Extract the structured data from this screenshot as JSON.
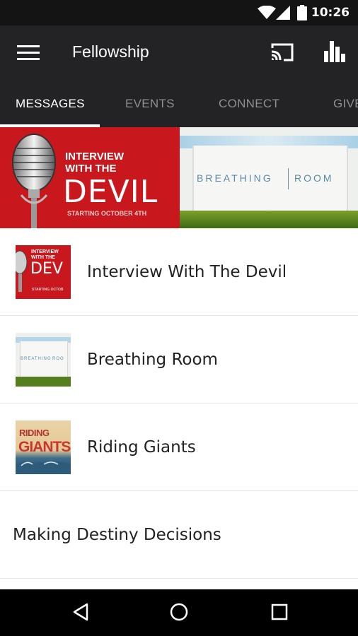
{
  "status_bar": {
    "time": "10:26"
  },
  "app_bar": {
    "title": "Fellowship"
  },
  "tabs": [
    {
      "label": "MESSAGES",
      "active": true
    },
    {
      "label": "EVENTS",
      "active": false
    },
    {
      "label": "CONNECT",
      "active": false
    },
    {
      "label": "GIVE",
      "active": false
    }
  ],
  "featured": {
    "left": {
      "line1": "INTERVIEW",
      "line2": "WITH THE",
      "big": "DEVIL",
      "date": "STARTING OCTOBER 4TH"
    },
    "right": {
      "word1": "BREATHING",
      "word2": "ROOM"
    }
  },
  "messages": [
    {
      "title": "Interview With The Devil"
    },
    {
      "title": "Breathing Room"
    },
    {
      "title": "Riding Giants"
    },
    {
      "title": "Making Destiny Decisions"
    }
  ],
  "thumbs": {
    "itw_line1": "INTERVIEW",
    "itw_line2": "WITH THE",
    "itw_big": "DEV",
    "itw_date": "STARTING OCTOB",
    "br_word1": "BREATHING",
    "br_word2": "ROO",
    "rg_word1": "RIDING",
    "rg_word2": "GIANTS"
  },
  "colors": {
    "app_bar": "#232326",
    "status_bar": "#141414",
    "accent_red": "#c8171d",
    "tab_inactive": "#8e8e93"
  }
}
